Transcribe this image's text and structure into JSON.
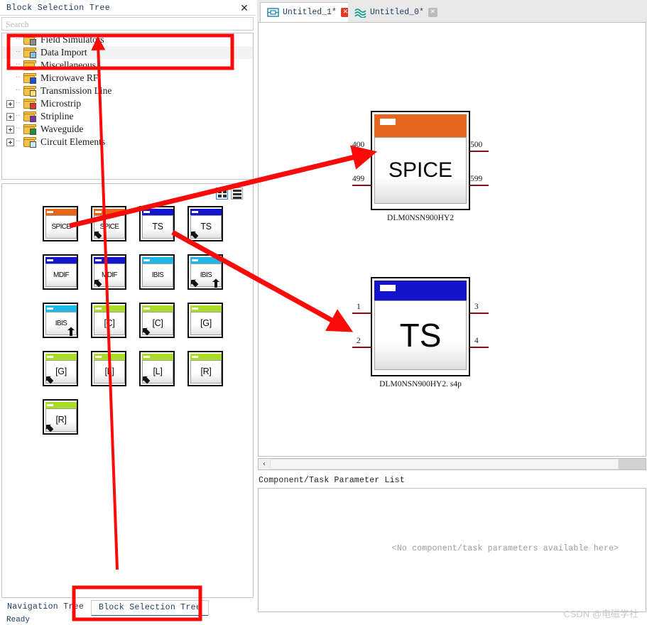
{
  "dock": {
    "title": "Block Selection Tree",
    "close_icon": "close-icon",
    "search_placeholder": "Search",
    "search_value": ""
  },
  "tree": {
    "items": [
      {
        "label": "Field Simulators",
        "expandable": false,
        "badge": "grey",
        "selected": false
      },
      {
        "label": "Data Import",
        "expandable": false,
        "badge": "blue",
        "selected": true
      },
      {
        "label": "Miscellaneous",
        "expandable": false,
        "badge": "none",
        "selected": false
      },
      {
        "label": "Microwave RF",
        "expandable": false,
        "badge": "navy",
        "selected": false
      },
      {
        "label": "Transmission Line",
        "expandable": false,
        "badge": "yellow",
        "selected": false
      },
      {
        "label": "Microstrip",
        "expandable": true,
        "badge": "red",
        "selected": false
      },
      {
        "label": "Stripline",
        "expandable": true,
        "badge": "purple",
        "selected": false
      },
      {
        "label": "Waveguide",
        "expandable": true,
        "badge": "green",
        "selected": false
      },
      {
        "label": "Circuit Elements",
        "expandable": true,
        "badge": "cyc",
        "selected": false
      }
    ]
  },
  "palette": {
    "view_grid_icon": "grid-view-icon",
    "view_list_icon": "list-view-icon",
    "active_view": "grid",
    "colors": {
      "spice": "#E8661C",
      "ts": "#1414CC",
      "mdif": "#1414CC",
      "ibis": "#1BB8E8",
      "passive": "#AADC28"
    },
    "blocks": [
      {
        "label": "SPICE",
        "color": "spice",
        "overlay": "none",
        "small": true
      },
      {
        "label": "SPICE",
        "color": "spice",
        "overlay": "arrow",
        "small": true
      },
      {
        "label": "TS",
        "color": "ts",
        "overlay": "none",
        "small": false
      },
      {
        "label": "TS",
        "color": "ts",
        "overlay": "arrow",
        "small": false
      },
      {
        "label": "MDIF",
        "color": "mdif",
        "overlay": "none",
        "small": true
      },
      {
        "label": "MDIF",
        "color": "mdif",
        "overlay": "arrow",
        "small": true
      },
      {
        "label": "IBIS",
        "color": "ibis",
        "overlay": "none",
        "small": true
      },
      {
        "label": "IBIS",
        "color": "ibis",
        "overlay": "both",
        "small": true
      },
      {
        "label": "IBIS",
        "color": "ibis",
        "overlay": "up",
        "small": true
      },
      {
        "label": "[C]",
        "color": "passive",
        "overlay": "none",
        "small": false
      },
      {
        "label": "[C]",
        "color": "passive",
        "overlay": "arrow",
        "small": false
      },
      {
        "label": "[G]",
        "color": "passive",
        "overlay": "none",
        "small": false
      },
      {
        "label": "[G]",
        "color": "passive",
        "overlay": "arrow",
        "small": false
      },
      {
        "label": "[L]",
        "color": "passive",
        "overlay": "none",
        "small": false
      },
      {
        "label": "[L]",
        "color": "passive",
        "overlay": "arrow",
        "small": false
      },
      {
        "label": "[R]",
        "color": "passive",
        "overlay": "none",
        "small": false
      },
      {
        "label": "[R]",
        "color": "passive",
        "overlay": "arrow",
        "small": false
      }
    ]
  },
  "tabs": [
    {
      "label": "Untitled_1*",
      "active": true,
      "close_style": "red",
      "icon": "schematic-icon"
    },
    {
      "label": "Untitled_0*",
      "active": false,
      "close_style": "grey",
      "icon": "waveform-icon"
    }
  ],
  "canvas": {
    "blocks": [
      {
        "name": "spice-block",
        "label": "SPICE",
        "color": "#E8661C",
        "caption": "DLM0NSN900HY2",
        "pins_left": [
          "400",
          "499"
        ],
        "pins_right": [
          "500",
          "599"
        ]
      },
      {
        "name": "ts-block",
        "label": "TS",
        "color": "#1414CC",
        "caption": "DLM0NSN900HY2. s4p",
        "pins_left": [
          "1",
          "2"
        ],
        "pins_right": [
          "3",
          "4"
        ]
      }
    ]
  },
  "hscroll": {
    "left_arrow": "‹"
  },
  "parameters": {
    "title": "Component/Task Parameter List",
    "empty_message": "<No component/task parameters available here>"
  },
  "bottom_tabs": [
    {
      "label": "Navigation Tree",
      "active": false
    },
    {
      "label": "Block Selection Tree",
      "active": true
    }
  ],
  "statusbar": {
    "text": "Ready"
  },
  "watermark": {
    "text": "CSDN @电磁学社"
  },
  "annotations": {
    "color": "#FB0A0A"
  }
}
